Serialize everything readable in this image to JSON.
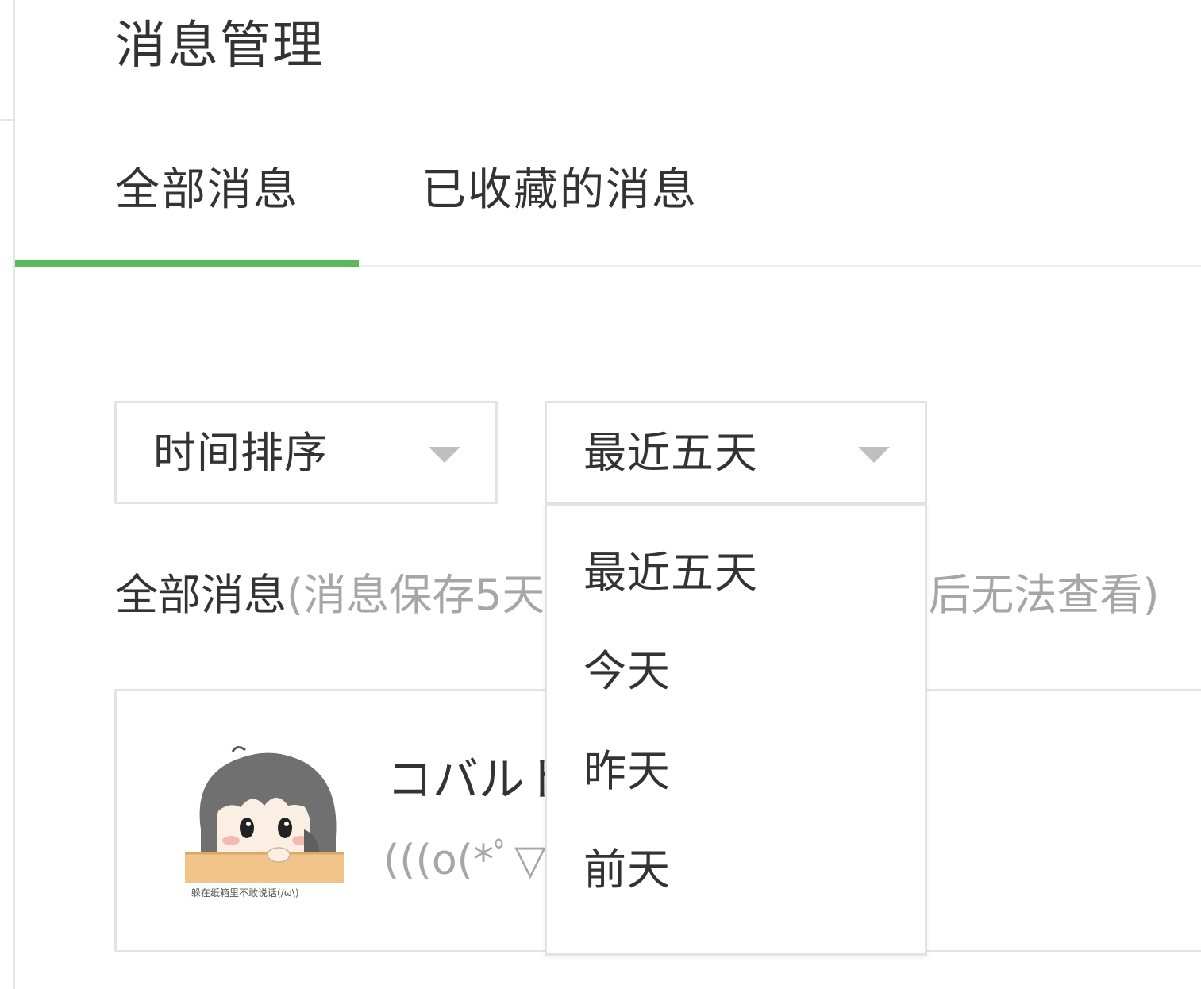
{
  "page": {
    "title": "消息管理"
  },
  "tabs": [
    {
      "label": "全部消息",
      "active": true
    },
    {
      "label": "已收藏的消息",
      "active": false
    }
  ],
  "filters": {
    "sort": {
      "value": "时间排序"
    },
    "range": {
      "value": "最近五天",
      "options": [
        "最近五天",
        "今天",
        "昨天",
        "前天"
      ],
      "open": true
    }
  },
  "section": {
    "title": "全部消息",
    "note_visible_left": "(消息保存5天",
    "note_visible_right": "后无法查看)"
  },
  "messages": [
    {
      "avatar_caption": "躲在纸箱里不敢说话(/ω\\)",
      "name_visible": "コバルト",
      "preview_visible": "(((o(*ﾟ▽"
    }
  ],
  "colors": {
    "accent": "#5cb85c",
    "text": "#333333",
    "muted": "#a6a6a6",
    "border": "#e3e3e3"
  },
  "icons": {
    "dropdown_caret": "chevron-down-icon"
  }
}
